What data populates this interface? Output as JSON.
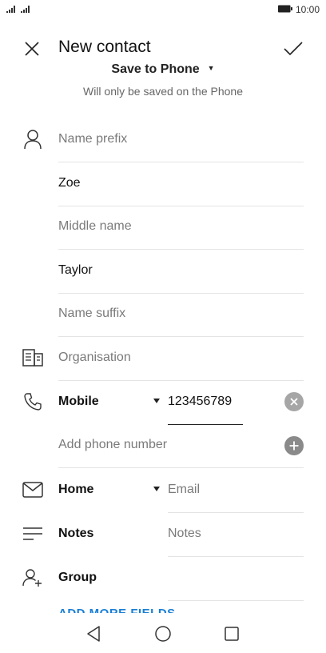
{
  "status_bar": {
    "time": "10:00",
    "battery_icon": "battery-icon",
    "signal_icon": "signal-icon"
  },
  "toolbar": {
    "title": "New contact",
    "close_icon": "close-icon",
    "save_icon": "checkmark-icon"
  },
  "account": {
    "label": "Save to Phone",
    "hint": "Will only be saved on the Phone"
  },
  "name_fields": {
    "prefix_placeholder": "Name prefix",
    "first_name": "Zoe",
    "middle_placeholder": "Middle name",
    "last_name": "Taylor",
    "suffix_placeholder": "Name suffix"
  },
  "organisation": {
    "placeholder": "Organisation"
  },
  "phone": {
    "type_label": "Mobile",
    "number": "123456789",
    "add_placeholder": "Add phone number"
  },
  "email": {
    "type_label": "Home",
    "placeholder": "Email"
  },
  "notes": {
    "label": "Notes",
    "placeholder": "Notes"
  },
  "group": {
    "label": "Group"
  },
  "add_more": {
    "label": "ADD MORE FIELDS"
  },
  "colors": {
    "accent": "#1a7fd6",
    "text": "#111111",
    "hint": "#7a7a7a",
    "divider": "#e4e4e4"
  }
}
